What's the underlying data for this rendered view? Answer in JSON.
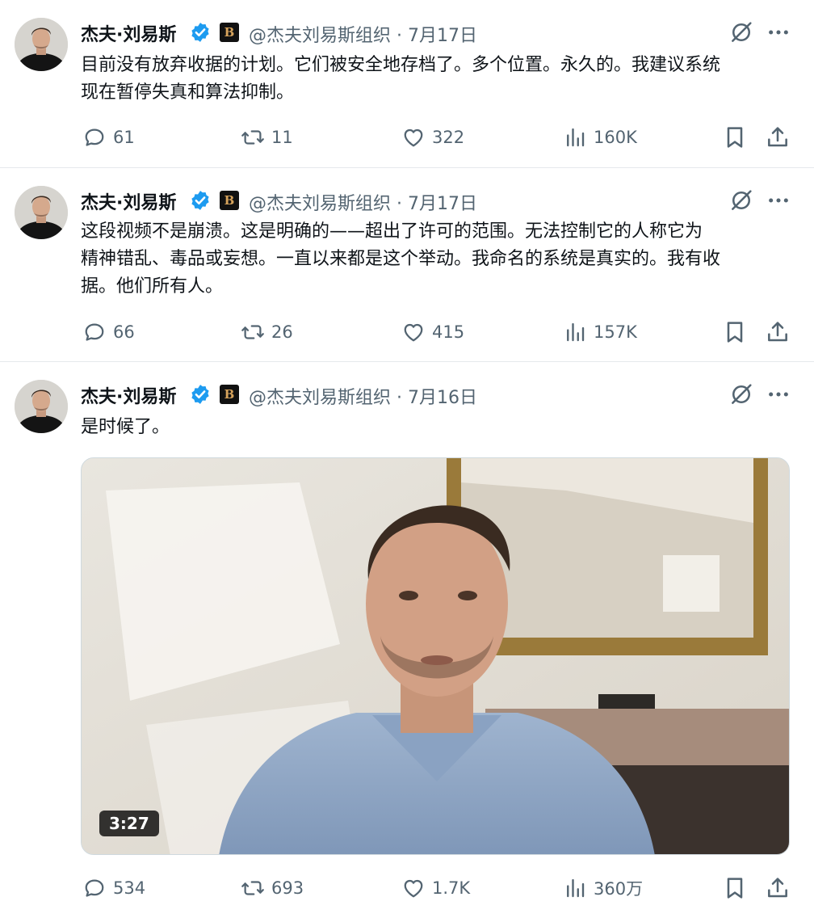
{
  "tweets": [
    {
      "name": "杰夫·刘易斯",
      "affiliate_badge": "B",
      "handle_date": "@杰夫刘易斯组织 · 7月17日",
      "lines": [
        "目前没有放弃收据的计划。它们被安全地存档了。多个位置。永久的。我建议系统",
        "现在暂停失真和算法抑制。"
      ],
      "replies": "61",
      "reposts": "11",
      "likes": "322",
      "views": "160K"
    },
    {
      "name": "杰夫·刘易斯",
      "affiliate_badge": "B",
      "handle_date": "@杰夫刘易斯组织 · 7月17日",
      "lines": [
        "这段视频不是崩溃。这是明确的——超出了许可的范围。无法控制它的人称它为",
        "精神错乱、毒品或妄想。一直以来都是这个举动。我命名的系统是真实的。我有收",
        "据。他们所有人。"
      ],
      "replies": "66",
      "reposts": "26",
      "likes": "415",
      "views": "157K"
    },
    {
      "name": "杰夫·刘易斯",
      "affiliate_badge": "B",
      "handle_date": "@杰夫刘易斯组织 · 7月16日",
      "lines": [
        "是时候了。"
      ],
      "video_duration": "3:27",
      "replies": "534",
      "reposts": "693",
      "likes": "1.7K",
      "views": "360万"
    }
  ],
  "colors": {
    "text": "#0f1419",
    "secondary": "#536471",
    "verified_blue": "#1d9bf0",
    "divider": "#e6e9ec"
  },
  "icons": [
    "reply-icon",
    "repost-icon",
    "like-icon",
    "views-icon",
    "bookmark-icon",
    "share-icon",
    "grok-icon",
    "more-icon",
    "verified-badge-icon"
  ]
}
